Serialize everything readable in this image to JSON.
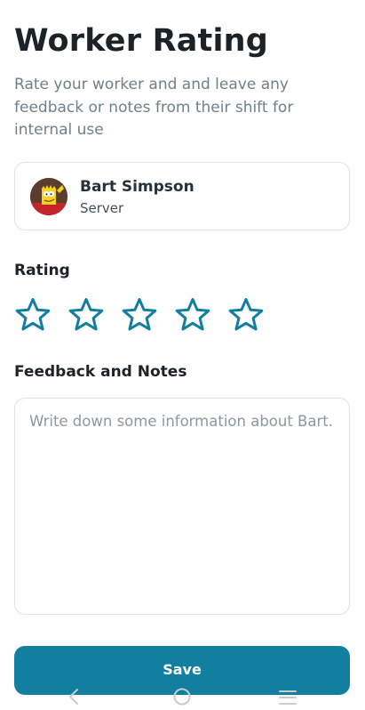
{
  "header": {
    "title": "Worker Rating",
    "subtitle": "Rate your worker and and leave any feedback or notes from their shift for internal use"
  },
  "worker": {
    "name": "Bart Simpson",
    "role": "Server",
    "avatar_icon": "bart-simpson-avatar"
  },
  "rating": {
    "label": "Rating",
    "max": 5,
    "value": 0,
    "star_icon": "star-outline-icon",
    "star_color": "#137fa0"
  },
  "feedback": {
    "label": "Feedback and Notes",
    "value": "",
    "placeholder": "Write down some information about Bart."
  },
  "actions": {
    "save_label": "Save",
    "save_color": "#137fa0"
  },
  "system_nav": {
    "back_icon": "chevron-left-icon",
    "home_icon": "circle-home-icon",
    "recents_icon": "menu-lines-icon"
  }
}
